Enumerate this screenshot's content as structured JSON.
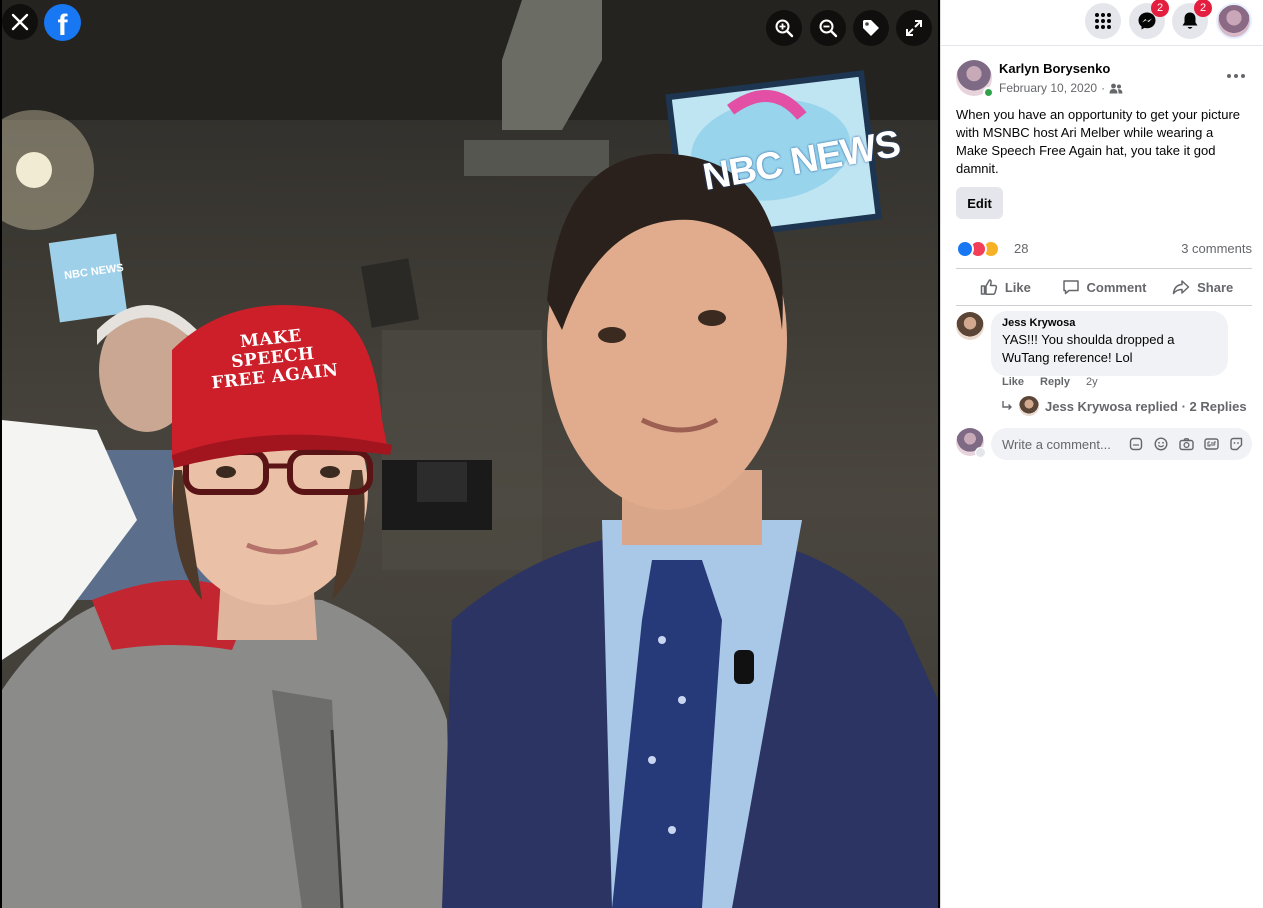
{
  "viewer": {
    "photo": {
      "hat_text_line1": "MAKE SPEECH",
      "hat_text_line2": "FREE AGAIN",
      "tv_text": "NBC NEWS",
      "tv_small_text": "NBC NEWS"
    },
    "brand_logo": "f",
    "controls": [
      "close-icon",
      "zoom-in-icon",
      "zoom-out-icon",
      "tag-icon",
      "fullscreen-icon"
    ]
  },
  "topbar": {
    "menu_icon": "grid-icon",
    "messenger_badge": "2",
    "notifications_badge": "2"
  },
  "post": {
    "author": "Karlyn Borysenko",
    "date": "February 10, 2020",
    "date_separator": "·",
    "text": "When you have an opportunity to get your picture with MSNBC host Ari Melber while wearing a Make Speech Free Again hat, you take it god damnit.",
    "edit_label": "Edit",
    "reaction_count": "28",
    "comment_count": "3 comments",
    "actions": {
      "like": "Like",
      "comment": "Comment",
      "share": "Share"
    }
  },
  "comment": {
    "author": "Jess Krywosa",
    "text": "YAS!!! You shoulda dropped a WuTang reference! Lol",
    "like_label": "Like",
    "reply_label": "Reply",
    "age": "2y",
    "replies_text": "Jess Krywosa replied · 2 Replies"
  },
  "composer": {
    "placeholder": "Write a comment..."
  },
  "colors": {
    "facebook_blue": "#1877f2",
    "badge_red": "#e41e3f",
    "online_green": "#31a24c",
    "secondary_text": "#65676b"
  }
}
